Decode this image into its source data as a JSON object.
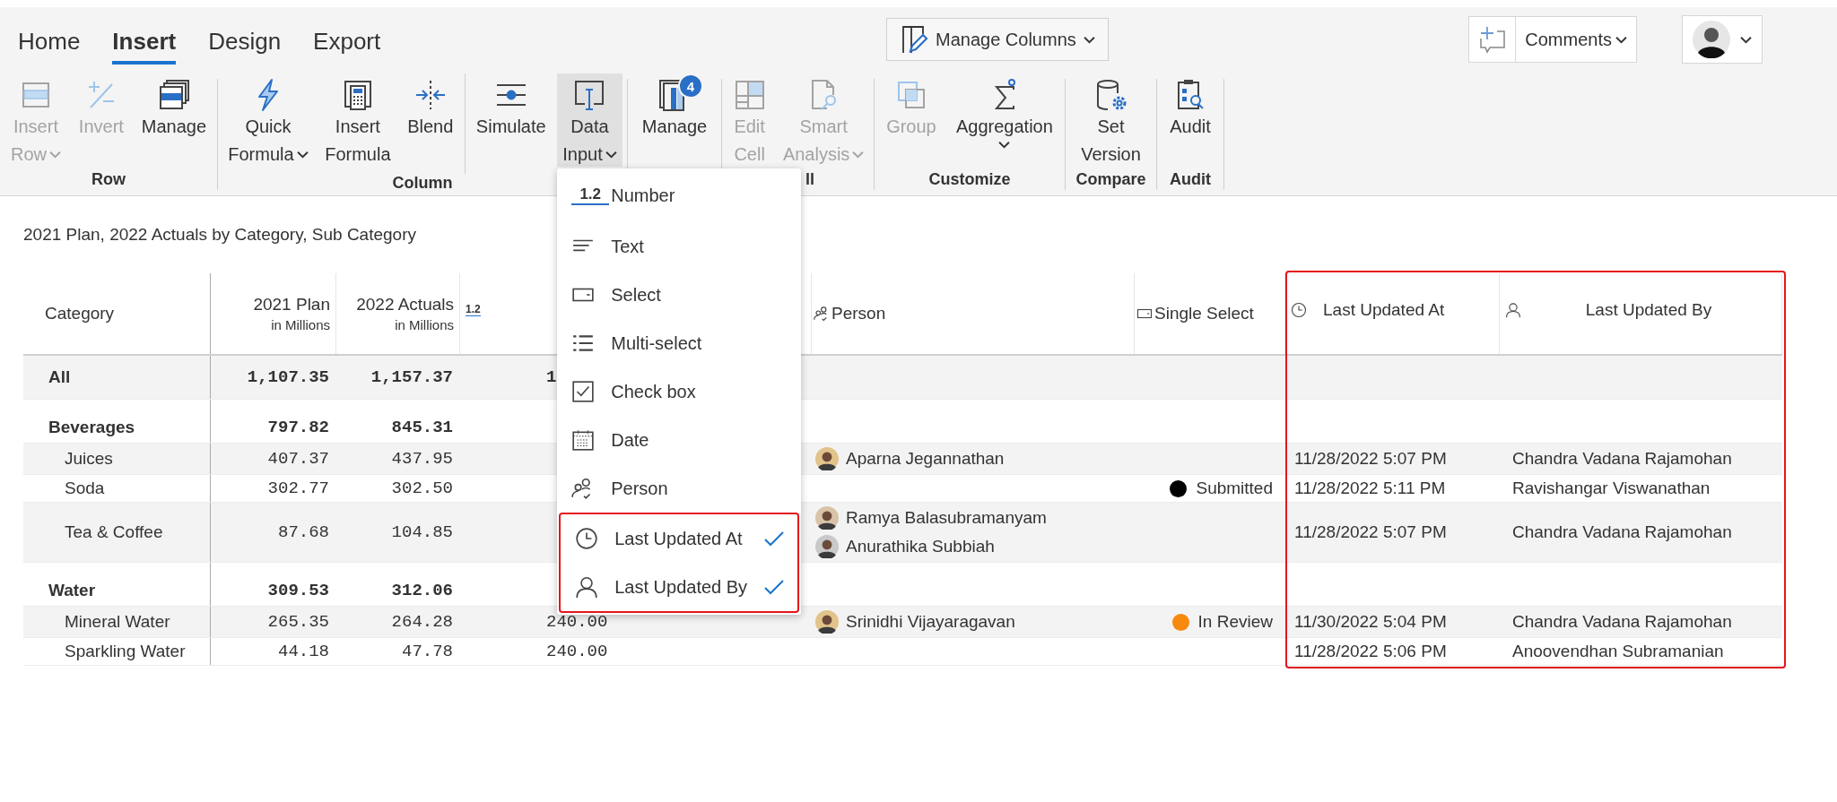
{
  "tabs": [
    {
      "label": "Home",
      "selected": false
    },
    {
      "label": "Insert",
      "selected": true
    },
    {
      "label": "Design",
      "selected": false
    },
    {
      "label": "Export",
      "selected": false
    }
  ],
  "manage_columns": {
    "label": "Manage Columns"
  },
  "comments": {
    "label": "Comments"
  },
  "ribbon": {
    "groups": [
      {
        "label": "Row",
        "label_clipped": false,
        "buttons": [
          {
            "kind": "insert-row",
            "lines": [
              "Insert",
              "Row"
            ],
            "dropdown": true,
            "disabled": true,
            "selected": false,
            "separator_before": false
          },
          {
            "kind": "invert",
            "lines": [
              "Invert"
            ],
            "dropdown": false,
            "disabled": true,
            "selected": false,
            "separator_before": false
          },
          {
            "kind": "manage-rows",
            "lines": [
              "Manage"
            ],
            "dropdown": false,
            "disabled": false,
            "selected": false,
            "separator_before": false
          }
        ]
      },
      {
        "label": "Column",
        "label_clipped": false,
        "buttons": [
          {
            "kind": "quick-formula",
            "lines": [
              "Quick",
              "Formula"
            ],
            "dropdown": true,
            "disabled": false,
            "selected": false,
            "separator_before": false
          },
          {
            "kind": "insert-formula",
            "lines": [
              "Insert",
              "Formula"
            ],
            "dropdown": false,
            "disabled": false,
            "selected": false,
            "separator_before": false
          },
          {
            "kind": "blend",
            "lines": [
              "Blend"
            ],
            "dropdown": false,
            "disabled": false,
            "selected": false,
            "separator_before": false
          },
          {
            "kind": "simulate",
            "lines": [
              "Simulate"
            ],
            "dropdown": false,
            "disabled": false,
            "selected": false,
            "separator_before": true
          },
          {
            "kind": "data-input",
            "lines": [
              "Data",
              "Input"
            ],
            "dropdown": true,
            "disabled": false,
            "selected": true,
            "separator_before": false,
            "menu": {
              "items": [
                {
                  "kind": "number",
                  "icon_text": "1.2",
                  "label": "Number",
                  "checked": false
                },
                {
                  "kind": "text",
                  "label": "Text",
                  "checked": false
                },
                {
                  "kind": "select",
                  "label": "Select",
                  "checked": false
                },
                {
                  "kind": "multi-select",
                  "label": "Multi-select",
                  "checked": false
                },
                {
                  "kind": "checkbox",
                  "label": "Check box",
                  "checked": false
                },
                {
                  "kind": "date",
                  "label": "Date",
                  "checked": false
                },
                {
                  "kind": "person",
                  "label": "Person",
                  "checked": false
                }
              ],
              "highlighted_items": [
                {
                  "kind": "time",
                  "label": "Last Updated At",
                  "checked": true
                },
                {
                  "kind": "user",
                  "label": "Last Updated By",
                  "checked": true
                }
              ]
            }
          }
        ]
      },
      {
        "buttons": [
          {
            "kind": "manage-columns",
            "lines": [
              "Manage"
            ],
            "badge": "4",
            "dropdown": false,
            "disabled": false,
            "selected": false,
            "separator_before": false
          }
        ]
      },
      {
        "label": "ll",
        "label_clipped": true,
        "buttons": [
          {
            "kind": "edit-cell",
            "lines": [
              "Edit",
              "Cell"
            ],
            "dropdown": false,
            "disabled": true,
            "selected": false,
            "separator_before": false
          },
          {
            "kind": "smart-analysis",
            "lines": [
              "Smart",
              "Analysis"
            ],
            "dropdown": true,
            "disabled": true,
            "selected": false,
            "separator_before": false
          }
        ]
      },
      {
        "label": "Customize",
        "label_clipped": false,
        "buttons": [
          {
            "kind": "group",
            "lines": [
              "Group"
            ],
            "dropdown": false,
            "disabled": true,
            "selected": false,
            "separator_before": false
          },
          {
            "kind": "aggregation",
            "lines": [
              "Aggregation"
            ],
            "dropdown": true,
            "disabled": false,
            "selected": false,
            "separator_before": false
          }
        ]
      },
      {
        "label": "Compare",
        "label_clipped": false,
        "buttons": [
          {
            "kind": "set-version",
            "lines": [
              "Set",
              "Version"
            ],
            "dropdown": false,
            "disabled": false,
            "selected": false,
            "separator_before": false
          }
        ]
      },
      {
        "label": "Audit",
        "label_clipped": false,
        "buttons": [
          {
            "kind": "audit",
            "lines": [
              "Audit"
            ],
            "dropdown": false,
            "disabled": false,
            "selected": false,
            "separator_before": false
          }
        ]
      }
    ]
  },
  "report": {
    "title": "2021 Plan, 2022 Actuals by Category, Sub Category",
    "columns": [
      {
        "kind": "category",
        "label": "Category"
      },
      {
        "kind": "measure",
        "label": "2021 Plan",
        "sublabel": "in Millions"
      },
      {
        "kind": "measure",
        "label": "2022 Actuals",
        "sublabel": "in Millions"
      },
      {
        "kind": "number",
        "icon_text": "1.2"
      },
      {
        "kind": "person",
        "label": "Person"
      },
      {
        "kind": "select",
        "label": "Single Select"
      }
    ],
    "highlighted_columns": [
      {
        "kind": "time",
        "label": "Last Updated At"
      },
      {
        "kind": "user",
        "label": "Last Updated By"
      }
    ],
    "rows": [
      {
        "kind": "total",
        "shaded": true,
        "category": "All",
        "plan": "1,107.35",
        "actual": "1,157.37",
        "number": "1"
      },
      {
        "kind": "group",
        "shaded": false,
        "category": "Beverages",
        "plan": "797.82",
        "actual": "845.31"
      },
      {
        "kind": "item",
        "shaded": true,
        "category": "Juices",
        "plan": "407.37",
        "actual": "437.95",
        "persons": [
          {
            "name": "Aparna Jegannathan"
          }
        ],
        "updated_at": "11/28/2022 5:07 PM",
        "updated_by": "Chandra Vadana Rajamohan"
      },
      {
        "kind": "item",
        "shaded": false,
        "category": "Soda",
        "plan": "302.77",
        "actual": "302.50",
        "status": {
          "label": "Submitted",
          "color": "#000000"
        },
        "updated_at": "11/28/2022 5:11 PM",
        "updated_by": "Ravishangar Viswanathan"
      },
      {
        "kind": "item",
        "shaded": true,
        "category": "Tea & Coffee",
        "plan": "87.68",
        "actual": "104.85",
        "persons": [
          {
            "name": "Ramya Balasubramanyam"
          },
          {
            "name": "Anurathika Subbiah"
          }
        ],
        "updated_at": "11/28/2022 5:07 PM",
        "updated_by": "Chandra Vadana Rajamohan"
      },
      {
        "kind": "group",
        "shaded": false,
        "category": "Water",
        "plan": "309.53",
        "actual": "312.06"
      },
      {
        "kind": "item",
        "shaded": true,
        "category": "Mineral Water",
        "plan": "265.35",
        "actual": "264.28",
        "number": "240.00",
        "persons": [
          {
            "name": "Srinidhi Vijayaragavan"
          }
        ],
        "status": {
          "label": "In Review",
          "color": "#f7890d"
        },
        "updated_at": "11/30/2022 5:04 PM",
        "updated_by": "Chandra Vadana Rajamohan"
      },
      {
        "kind": "item",
        "shaded": false,
        "category": "Sparkling Water",
        "plan": "44.18",
        "actual": "47.78",
        "number": "240.00",
        "updated_at": "11/28/2022 5:06 PM",
        "updated_by": "Anoovendhan Subramanian"
      }
    ]
  }
}
